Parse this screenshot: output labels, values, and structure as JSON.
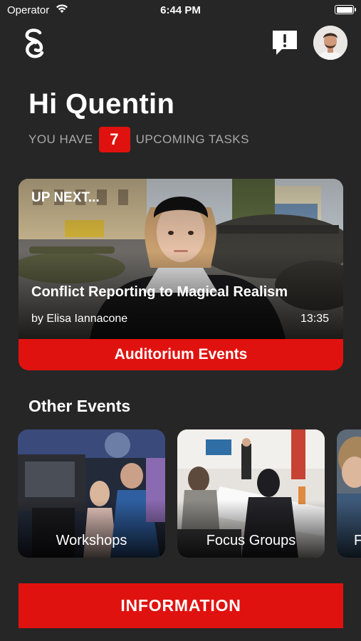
{
  "status_bar": {
    "carrier": "Operator",
    "time": "6:44 PM"
  },
  "header": {
    "logo_icon": "s-logo-icon",
    "alert_icon": "exclamation-bubble-icon",
    "avatar_icon": "user-avatar"
  },
  "greeting": {
    "text": "Hi Quentin",
    "tasks_prefix": "YOU HAVE",
    "tasks_count": "7",
    "tasks_suffix": "UPCOMING TASKS"
  },
  "up_next": {
    "tag": "UP NEXT...",
    "title": "Conflict Reporting to Magical Realism",
    "author": "by Elisa Iannacone",
    "time": "13:35",
    "category_button": "Auditorium Events"
  },
  "other_events": {
    "title": "Other Events",
    "items": [
      {
        "label": "Workshops"
      },
      {
        "label": "Focus Groups"
      },
      {
        "label": "F"
      }
    ]
  },
  "information_button": "INFORMATION",
  "colors": {
    "background": "#262626",
    "accent": "#e0120f",
    "muted_text": "#a9a9a9"
  }
}
